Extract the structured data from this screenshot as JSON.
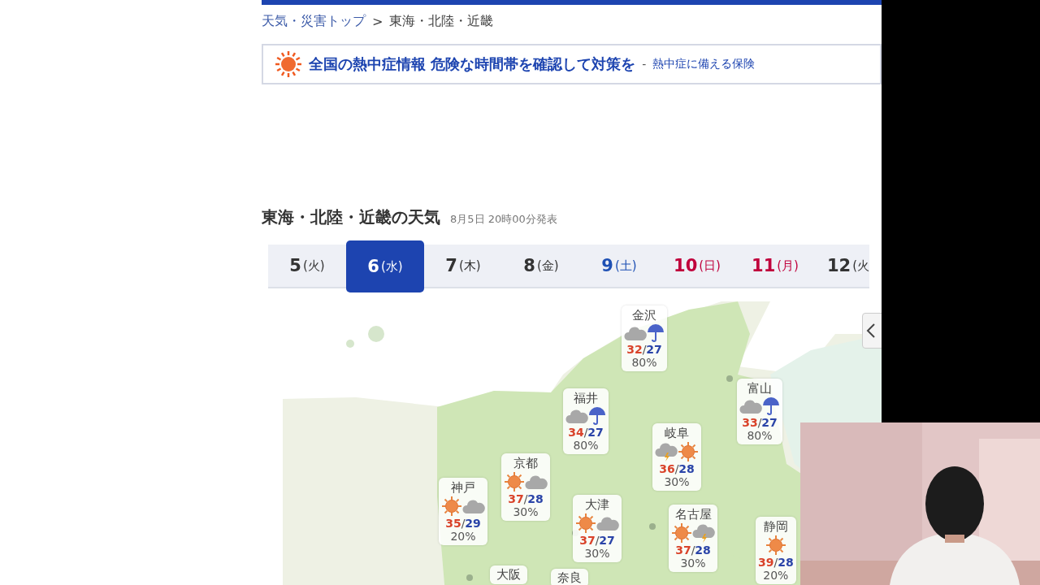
{
  "breadcrumb": {
    "link": "天気・災害トップ",
    "separator": ">",
    "current": "東海・北陸・近畿"
  },
  "banner": {
    "headline": "全国の熱中症情報 危険な時間帯を確認して対策を",
    "dash": "-",
    "sublink": "熱中症に備える保険"
  },
  "section": {
    "title": "東海・北陸・近畿の天気",
    "issued": "8月5日 20時00分発表"
  },
  "tabs": [
    {
      "day": "5",
      "weekday": "(火)",
      "color": "#333333",
      "selected": false
    },
    {
      "day": "6",
      "weekday": "(水)",
      "selected": true
    },
    {
      "day": "7",
      "weekday": "(木)",
      "color": "#333333",
      "selected": false
    },
    {
      "day": "8",
      "weekday": "(金)",
      "color": "#333333",
      "selected": false
    },
    {
      "day": "9",
      "weekday": "(土)",
      "color": "#1e50b4",
      "selected": false
    },
    {
      "day": "10",
      "weekday": "(日)",
      "color": "#c0003c",
      "selected": false
    },
    {
      "day": "11",
      "weekday": "(月)",
      "color": "#c0003c",
      "selected": false
    },
    {
      "day": "12",
      "weekday": "(火",
      "color": "#333333",
      "selected": false
    }
  ],
  "map": {
    "cities": [
      {
        "name": "金沢",
        "icons": [
          {
            "kind": "cloud"
          },
          {
            "kind": "umbrella"
          }
        ],
        "high": "32",
        "slash": "/",
        "low": "27",
        "pop": "80%"
      },
      {
        "name": "福井",
        "icons": [
          {
            "kind": "cloud"
          },
          {
            "kind": "umbrella"
          }
        ],
        "high": "34",
        "slash": "/",
        "low": "27",
        "pop": "80%"
      },
      {
        "name": "富山",
        "icons": [
          {
            "kind": "cloud"
          },
          {
            "kind": "umbrella"
          }
        ],
        "high": "33",
        "slash": "/",
        "low": "27",
        "pop": "80%"
      },
      {
        "name": "岐阜",
        "icons": [
          {
            "kind": "thunder"
          },
          {
            "kind": "sun"
          }
        ],
        "high": "36",
        "slash": "/",
        "low": "28",
        "pop": "30%"
      },
      {
        "name": "京都",
        "icons": [
          {
            "kind": "sun"
          },
          {
            "kind": "cloud"
          }
        ],
        "high": "37",
        "slash": "/",
        "low": "28",
        "pop": "30%"
      },
      {
        "name": "神戸",
        "icons": [
          {
            "kind": "sun"
          },
          {
            "kind": "cloud"
          }
        ],
        "high": "35",
        "slash": "/",
        "low": "29",
        "pop": "20%"
      },
      {
        "name": "大津",
        "icons": [
          {
            "kind": "sun"
          },
          {
            "kind": "cloud"
          }
        ],
        "high": "37",
        "slash": "/",
        "low": "27",
        "pop": "30%"
      },
      {
        "name": "名古屋",
        "icons": [
          {
            "kind": "sun"
          },
          {
            "kind": "thunder"
          }
        ],
        "high": "37",
        "slash": "/",
        "low": "28",
        "pop": "30%"
      },
      {
        "name": "大阪"
      },
      {
        "name": "奈良"
      },
      {
        "name": "静岡",
        "icons": [
          {
            "kind": "sun"
          }
        ],
        "high": "39",
        "slash": "/",
        "low": "28",
        "pop": "20%"
      }
    ]
  }
}
